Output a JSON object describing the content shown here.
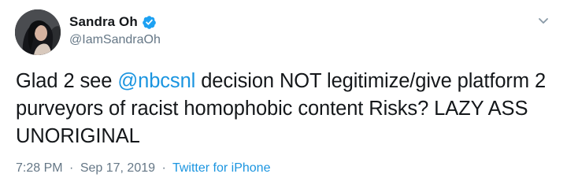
{
  "tweet": {
    "author": {
      "display_name": "Sandra Oh",
      "handle": "@IamSandraOh",
      "verified": true
    },
    "text": {
      "prefix": "Glad 2 see ",
      "mention": "@nbcsnl",
      "suffix": " decision NOT legitimize/give platform 2 purveyors of racist homophobic content Risks? LAZY ASS UNORIGINAL"
    },
    "meta": {
      "time": "7:28 PM",
      "separator": "·",
      "date": "Sep 17, 2019",
      "source": "Twitter for iPhone"
    }
  },
  "icons": {
    "verified": "verified-badge-icon",
    "menu": "chevron-down-icon"
  },
  "colors": {
    "link": "#1b95e0",
    "secondary_text": "#657786",
    "primary_text": "#14171a",
    "verified": "#1da1f2"
  }
}
